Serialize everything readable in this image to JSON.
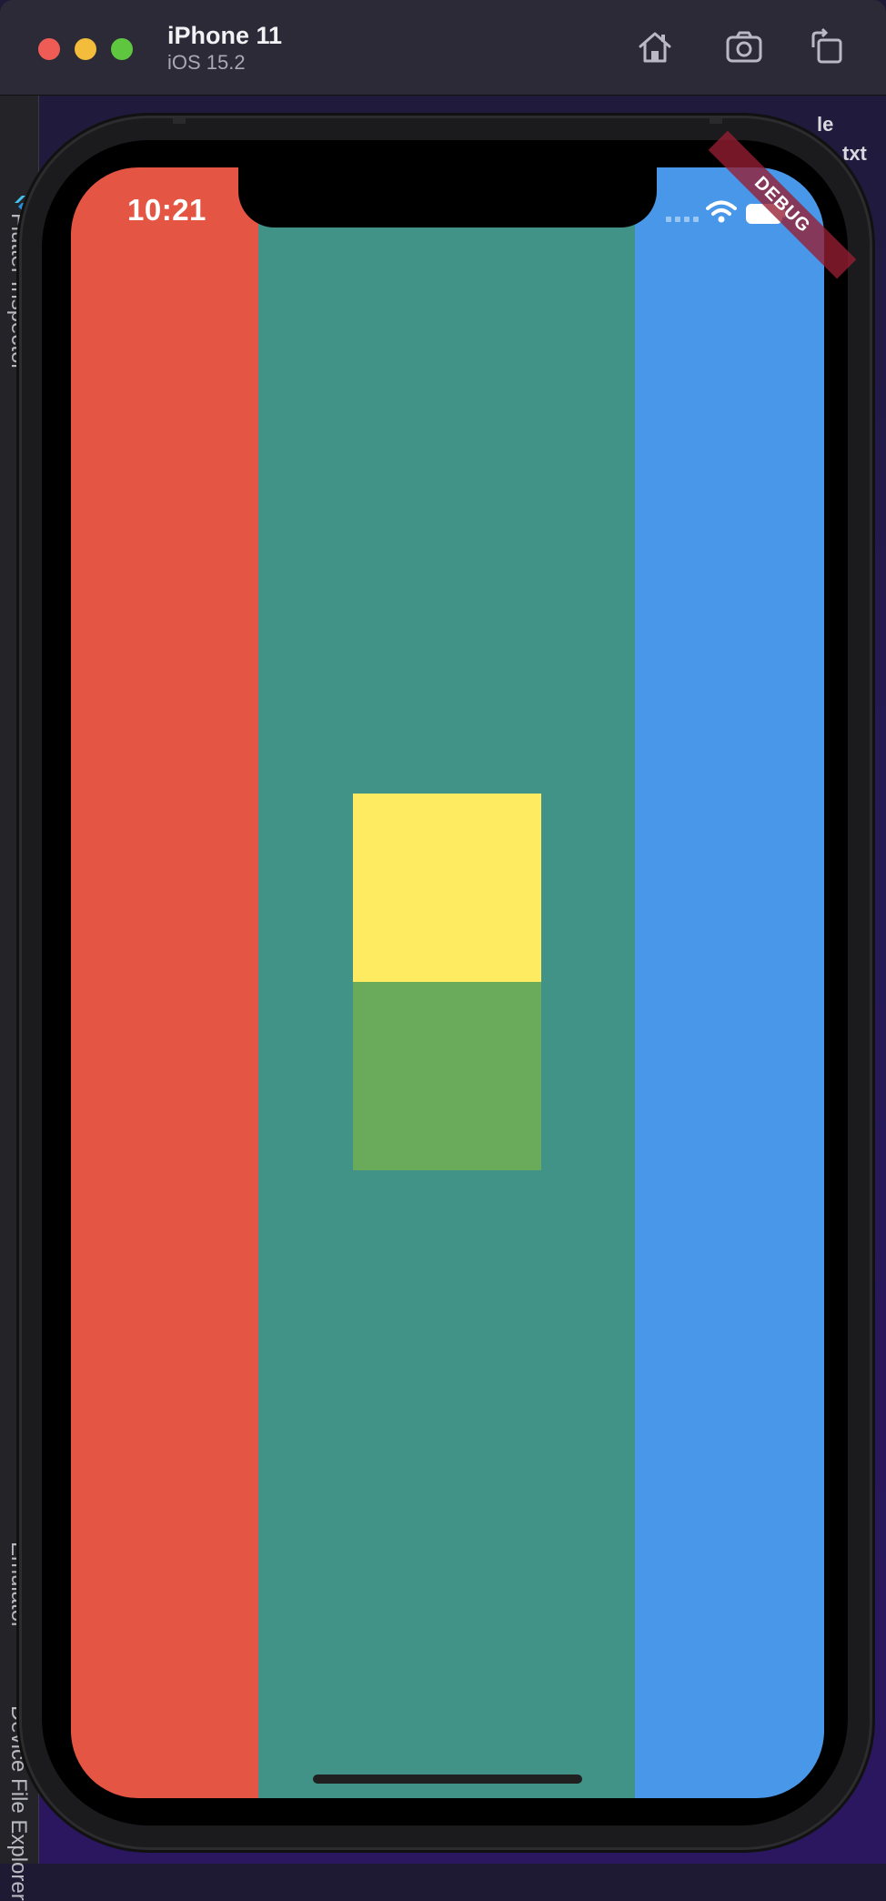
{
  "simulator": {
    "device_name": "iPhone 11",
    "os_version": "iOS 15.2",
    "toolbar": {
      "home_icon": "home-icon",
      "screenshot_icon": "camera-icon",
      "rotate_icon": "rotate-icon"
    }
  },
  "ide": {
    "left_panel_labels": [
      "Flutter Inspector",
      "Emulator",
      "Device File Explorer"
    ],
    "right_edge_text": [
      "le",
      "txt"
    ]
  },
  "phone": {
    "status_bar": {
      "time": "10:21",
      "icons": [
        "signal-icon",
        "wifi-icon",
        "battery-icon"
      ]
    },
    "debug_banner": "DEBUG",
    "app": {
      "columns": [
        {
          "name": "left-column",
          "color": "#e45543"
        },
        {
          "name": "center-column",
          "color": "#419387"
        },
        {
          "name": "right-column",
          "color": "#4897e9"
        }
      ],
      "boxes": [
        {
          "name": "yellow-box",
          "color": "#feeb62"
        },
        {
          "name": "green-box",
          "color": "#69ab5b"
        }
      ]
    }
  }
}
